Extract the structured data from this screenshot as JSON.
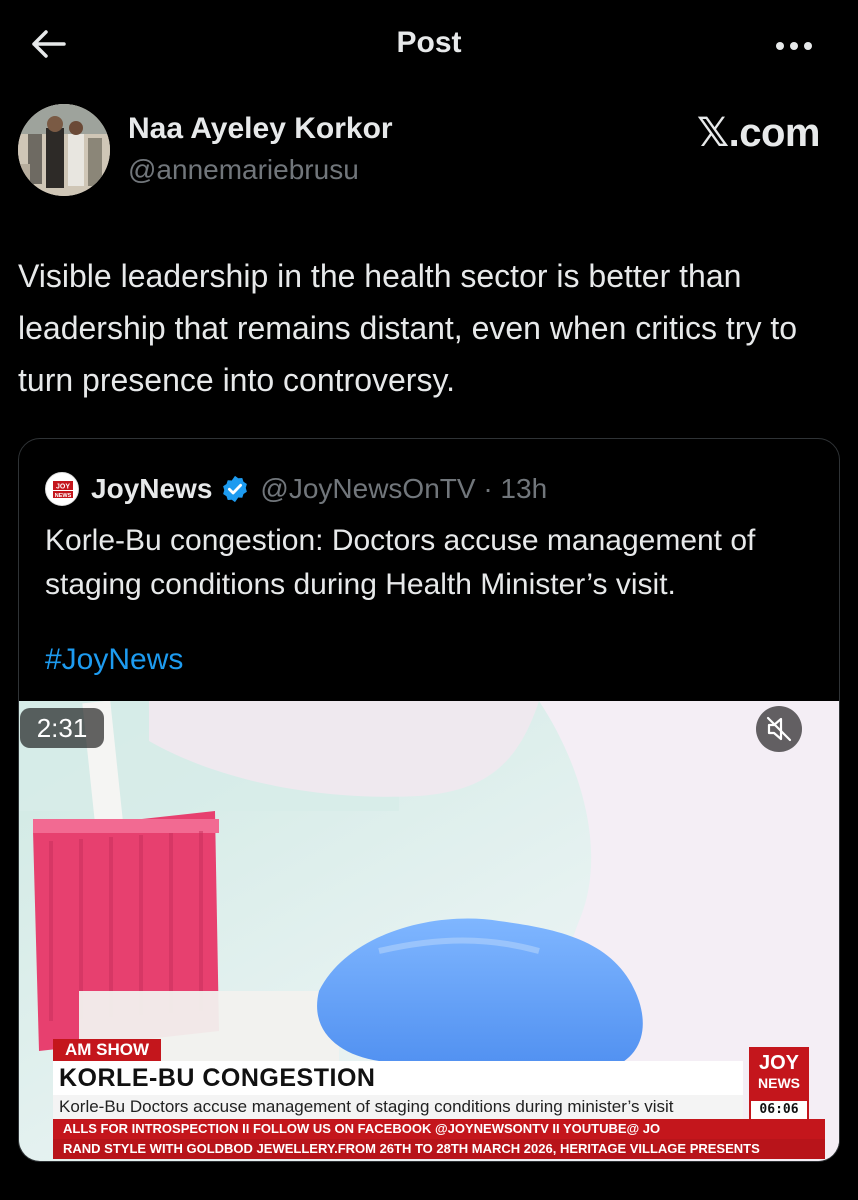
{
  "header": {
    "title": "Post",
    "back_icon": "arrow-left-icon",
    "more_icon": "more-horizontal-icon"
  },
  "author": {
    "name": "Naa Ayeley Korkor",
    "handle": "@annemariebrusu",
    "watermark": "𝕏.com"
  },
  "post": {
    "text": "Visible leadership in the health sector is better than leadership that remains distant, even when critics try to turn presence into controversy."
  },
  "quoted_post": {
    "name": "JoyNews",
    "verified": true,
    "handle_time": "@JoyNewsOnTV · 13h",
    "text": "Korle-Bu congestion: Doctors accuse management of staging conditions during Health Minister’s visit.",
    "hashtag": "#JoyNews",
    "logo_text": "JOY NEWS"
  },
  "video": {
    "program_tag": "AM SHOW",
    "headline": "KORLE-BU CONGESTION",
    "subheadline": "Korle-Bu Doctors accuse management of staging conditions during minister’s visit",
    "ticker_top": "ALLS FOR INTROSPECTION   II   FOLLOW US ON FACEBOOK @JOYNEWSONTV   II   YOUTUBE@ JO",
    "ticker_bottom": "RAND STYLE WITH GOLDBOD JEWELLERY.FROM 26TH TO 28TH MARCH 2026, HERITAGE VILLAGE PRESENTS",
    "brand_top": "JOY",
    "brand_bottom": "NEWS",
    "clock": "06:06",
    "duration": "2:31",
    "mute_icon": "speaker-muted-icon"
  },
  "colors": {
    "background": "#000000",
    "text": "#e7e9ea",
    "muted": "#71767b",
    "link": "#1d9bf0",
    "border": "#2f3336",
    "joy_red": "#c4161c"
  }
}
